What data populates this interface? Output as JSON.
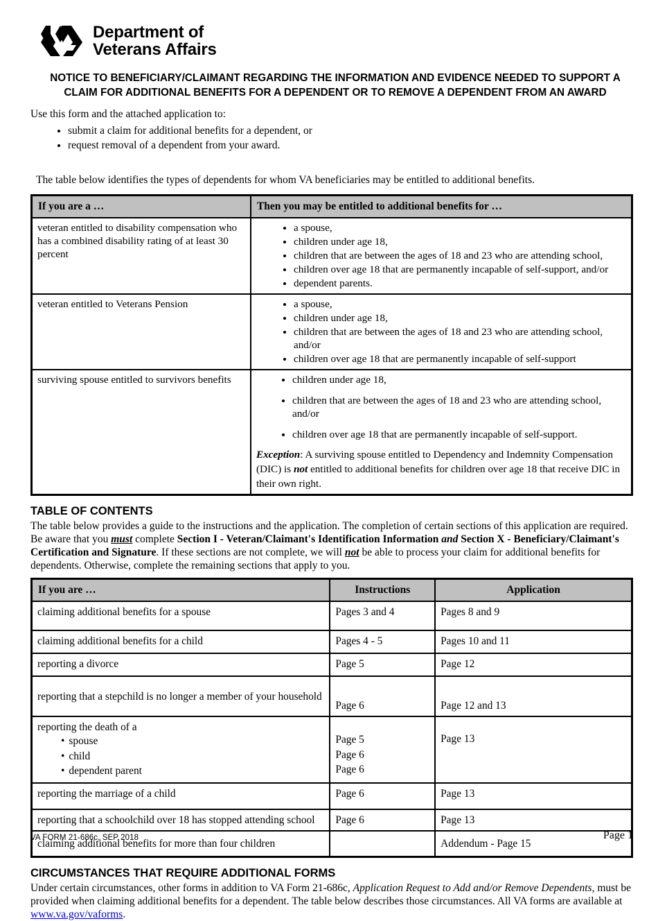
{
  "header": {
    "logo_line1": "Department of",
    "logo_line2": "Veterans Affairs",
    "logo_icon": "va-seal-icon"
  },
  "title": "NOTICE TO BENEFICIARY/CLAIMANT REGARDING THE INFORMATION AND EVIDENCE NEEDED TO SUPPORT A CLAIM FOR ADDITIONAL BENEFITS FOR A DEPENDENT OR TO REMOVE A DEPENDENT FROM AN AWARD",
  "intro": {
    "lead": "Use this form and the attached application to:",
    "bullets": [
      "submit a claim for additional benefits for a dependent, or",
      "request removal of a dependent from your award."
    ],
    "note": "The table below identifies the types of dependents for whom VA beneficiaries may be entitled to additional benefits."
  },
  "table1": {
    "headers": [
      "If you are a …",
      "Then you may be entitled to additional benefits for …"
    ],
    "rows": [
      {
        "who": "veteran entitled to disability compensation who has a combined disability rating of at least 30 percent",
        "benefits": [
          "a spouse,",
          "children under age 18,",
          "children that are between the ages of 18 and 23 who are attending school,",
          "children over age 18 that are permanently incapable of self-support, and/or",
          "dependent parents."
        ]
      },
      {
        "who": "veteran entitled to Veterans Pension",
        "benefits": [
          "a spouse,",
          "children under age 18,",
          "children that are between the ages of 18 and 23 who are attending school, and/or",
          "children over age 18 that are permanently incapable of self-support"
        ]
      },
      {
        "who": "surviving spouse entitled to survivors benefits",
        "benefits": [
          "children under age 18,",
          "children that are between the ages of 18 and 23 who are attending school, and/or",
          "children over age 18 that are permanently incapable of self-support."
        ],
        "exception_label": "Exception",
        "exception_part1": ": A surviving spouse entitled to Dependency and Indemnity Compensation (DIC) is ",
        "exception_emph": "not",
        "exception_part2": " entitled to additional benefits for children over age 18 that receive DIC in their own right."
      }
    ]
  },
  "toc": {
    "heading": "TABLE OF CONTENTS",
    "p_a": "The table below provides a guide to the instructions and the application. The completion of certain sections of this application are required. Be aware that you ",
    "p_must": "must",
    "p_b": " complete ",
    "p_sec1": "Section I - Veteran/Claimant's Identification Information",
    "p_and": " and ",
    "p_sec2": "Section X - Beneficiary/Claimant's Certification and Signature",
    "p_c": ". If these sections are not complete, we will ",
    "p_not": "not",
    "p_d": " be able to process your claim for additional benefits for dependents. Otherwise, complete the remaining sections that apply to you."
  },
  "table2": {
    "headers": [
      "If you are …",
      "Instructions",
      "Application"
    ],
    "rows": [
      {
        "who": "claiming additional benefits for a spouse",
        "instructions": "Pages 3 and 4",
        "application": "Pages 8 and 9"
      },
      {
        "who": "claiming additional benefits for a child",
        "instructions": "Pages 4 - 5",
        "application": "Pages 10 and 11"
      },
      {
        "who": "reporting a divorce",
        "instructions": "Page 5",
        "application": "Page 12"
      },
      {
        "who": "reporting that a stepchild is no longer a member of your household",
        "instructions": "Page 6",
        "application": "Page 12 and 13"
      },
      {
        "who": "reporting the death of a",
        "sub": [
          "spouse",
          "child",
          "dependent parent"
        ],
        "instructions_lines": [
          "Page 5",
          "Page 6",
          "Page 6"
        ],
        "application": "Page 13"
      },
      {
        "who": "reporting the marriage of a child",
        "instructions": "Page 6",
        "application": "Page 13"
      },
      {
        "who": "reporting that a schoolchild over 18 has stopped attending school",
        "instructions": "Page 6",
        "application": "Page 13"
      },
      {
        "who": "claiming additional benefits for more than four children",
        "instructions": "",
        "application": "Addendum - Page 15"
      }
    ]
  },
  "circumstances": {
    "heading": "CIRCUMSTANCES THAT REQUIRE ADDITIONAL FORMS",
    "p_a": "Under certain circumstances, other forms in addition to VA Form 21-686c, ",
    "p_italic": "Application Request to Add and/or Remove Dependents",
    "p_b": ", must be provided when claiming additional benefits for a dependent. The table below describes those circumstances. All VA forms are available at ",
    "link": "www.va.gov/vaforms",
    "p_c": "."
  },
  "footer": {
    "form_id": "VA FORM 21-686c, SEP 2018",
    "page": "Page 1"
  },
  "colors": {
    "header_gray": "#c0c0c0",
    "link_blue": "#0000cc",
    "ink": "#000000"
  }
}
